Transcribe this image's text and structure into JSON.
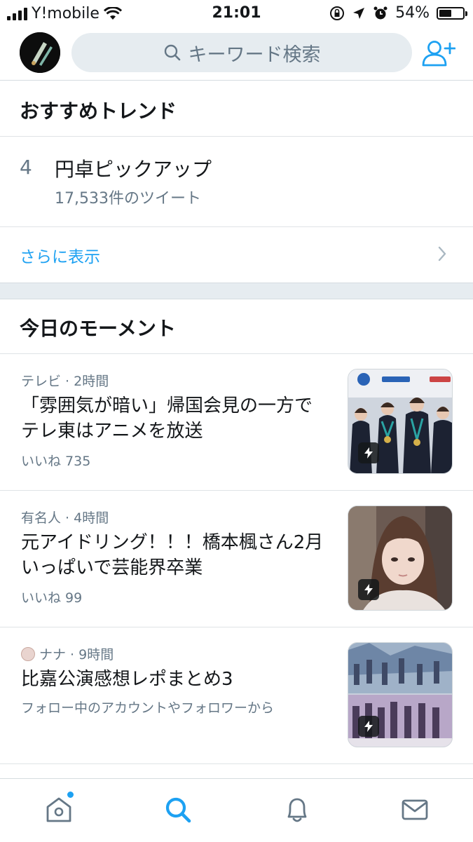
{
  "status_bar": {
    "carrier": "Y!mobile",
    "time": "21:01",
    "battery": "54%",
    "battery_level": 0.54,
    "icons": [
      "signal-icon",
      "wifi-icon",
      "orientation-lock-icon",
      "location-icon",
      "alarm-icon",
      "battery-icon"
    ]
  },
  "header": {
    "search_placeholder": "キーワード検索",
    "icons": [
      "avatar",
      "search-icon",
      "add-user-icon"
    ]
  },
  "trends": {
    "title": "おすすめトレンド",
    "items": [
      {
        "rank": "4",
        "name": "円卓ピックアップ",
        "count": "17,533件のツイート"
      }
    ],
    "show_more": "さらに表示"
  },
  "moments": {
    "title": "今日のモーメント",
    "items": [
      {
        "meta": "テレビ · 2時間",
        "title": "「雰囲気が暗い」帰国会見の一方でテレ東はアニメを放送",
        "sub": "いいね 735"
      },
      {
        "meta": "有名人 · 4時間",
        "title": "元アイドリング！！！橋本楓さん2月いっぱいで芸能界卒業",
        "sub": "いいね 99"
      },
      {
        "meta": "ナナ · 9時間",
        "title": "比嘉公演感想レポまとめ3",
        "sub": "フォロー中のアカウントやフォロワーから"
      }
    ]
  },
  "tab_bar": {
    "tabs": [
      "home-icon",
      "search-icon",
      "notifications-icon",
      "messages-icon"
    ],
    "active": "search-icon",
    "accent": "#1da1f2"
  }
}
